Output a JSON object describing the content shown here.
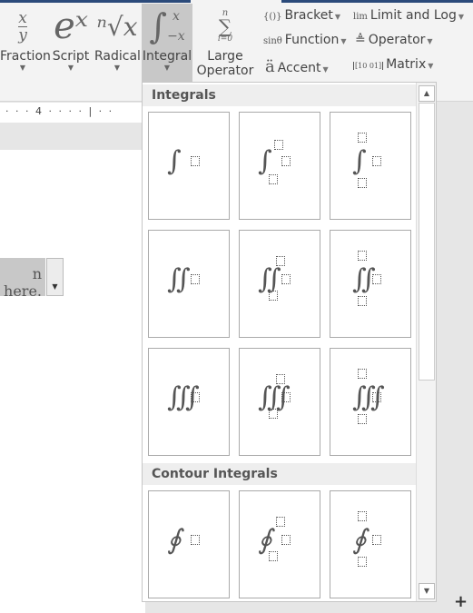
{
  "ribbon": {
    "big_buttons": [
      {
        "label": "Fraction",
        "icon": "fraction-icon",
        "glyph_num": "x",
        "glyph_den": "y"
      },
      {
        "label": "Script",
        "icon": "script-icon",
        "glyph": "eˣ"
      },
      {
        "label": "Radical",
        "icon": "radical-icon",
        "glyph": "ⁿ√x"
      },
      {
        "label": "Integral",
        "icon": "integral-icon",
        "glyph": "∫"
      },
      {
        "label1": "Large",
        "label2": "Operator",
        "icon": "large-operator-icon",
        "glyph_top": "n",
        "glyph": "∑",
        "glyph_bot": "i=0"
      }
    ],
    "small_buttons": [
      {
        "icon_text": "{()}",
        "label": "Bracket"
      },
      {
        "icon_text": "sinθ",
        "label": "Function"
      },
      {
        "icon_text": "ä",
        "label": "Accent"
      },
      {
        "icon_text": "lim",
        "label": "Limit and Log"
      },
      {
        "icon_text": "≜",
        "label": "Operator"
      },
      {
        "icon_text": "[10 01]",
        "label": "Matrix"
      }
    ]
  },
  "ruler": {
    "text": "· · · 4 · · · · | · ·"
  },
  "document": {
    "equation_text": "n here."
  },
  "gallery": {
    "sections": [
      {
        "title": "Integrals"
      },
      {
        "title": "Contour Integrals"
      }
    ],
    "integral_glyphs": [
      "∫",
      "∬",
      "∭"
    ],
    "contour_glyph": "∮"
  },
  "colors": {
    "active": "#c8c8c8",
    "accent": "#2b4a7a"
  }
}
